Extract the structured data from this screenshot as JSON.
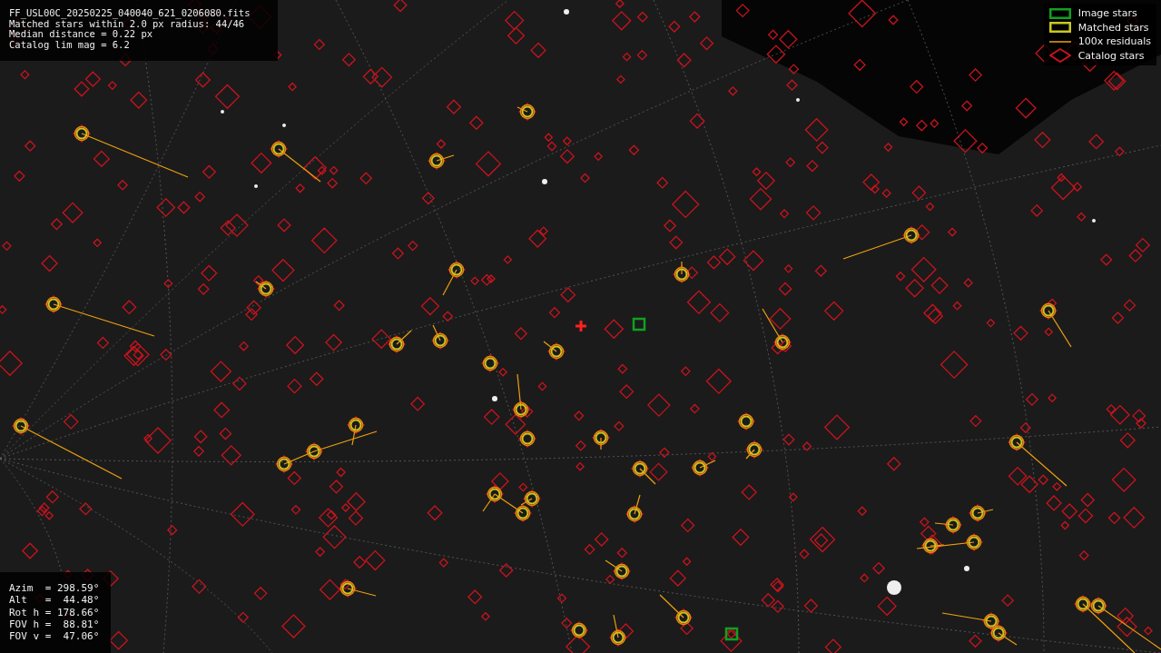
{
  "info": [
    "FF_USL00C_20250225_040040_621_0206080.fits",
    "Matched stars within 2.0 px radius: 44/46",
    "Median distance = 0.22 px",
    "Catalog lim mag = 6.2"
  ],
  "legend": [
    {
      "kind": "image",
      "label": "Image stars"
    },
    {
      "kind": "matched",
      "label": "Matched stars"
    },
    {
      "kind": "residual",
      "label": "100x residuals"
    },
    {
      "kind": "catalog",
      "label": "Catalog stars"
    }
  ],
  "pointing": [
    "Azim  = 298.59°",
    "Alt   =  44.48°",
    "Rot h = 178.66°",
    "FOV h =  88.81°",
    "FOV v =  47.06°"
  ]
}
